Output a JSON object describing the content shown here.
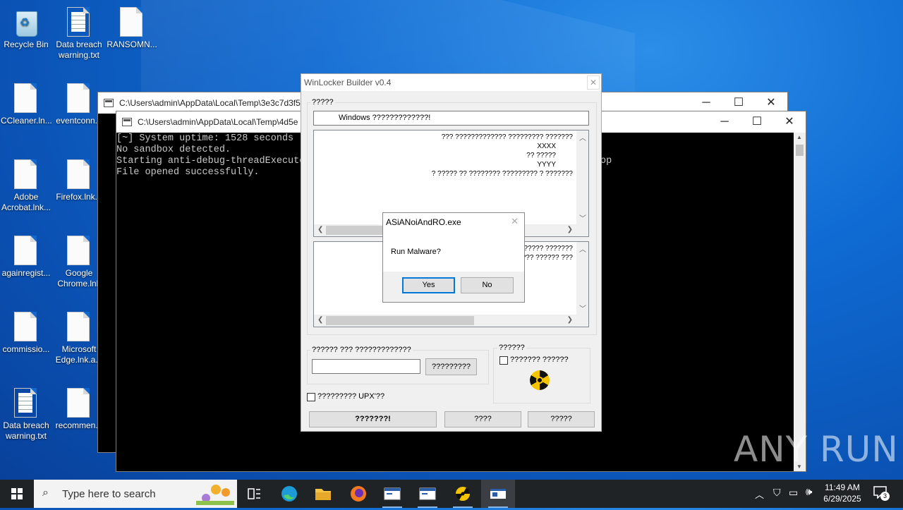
{
  "desktop": {
    "icons": [
      {
        "label": "Recycle Bin"
      },
      {
        "label": "Data breach warning.txt"
      },
      {
        "label": "RANSOMN..."
      },
      {
        "label": "CCleaner.ln..."
      },
      {
        "label": "eventconn..."
      },
      {
        "label": "Adobe Acrobat.lnk..."
      },
      {
        "label": "Firefox.lnk..."
      },
      {
        "label": "againregist..."
      },
      {
        "label": "Google Chrome.lnk"
      },
      {
        "label": "commissio..."
      },
      {
        "label": "Microsoft Edge.lnk.a..."
      },
      {
        "label": "Data breach warning.txt"
      },
      {
        "label": "recommen..."
      }
    ]
  },
  "console_back": {
    "title": "C:\\Users\\admin\\AppData\\Local\\Temp\\3e3c7d3f5"
  },
  "console_front": {
    "title": "C:\\Users\\admin\\AppData\\Local\\Temp\\4d5e",
    "lines": [
      "[~] System uptime: 1528 seconds",
      "No sandbox detected.",
      "Starting anti-debug-threadExecute",
      "File opened successfully."
    ],
    "clipped_tail": "op"
  },
  "winlocker": {
    "title": "WinLocker Builder v0.4",
    "group1_label": "?????",
    "header_input": "Windows ?????????????!",
    "memo1_lines": [
      "??? ????????????? ????????? ???????",
      "XXXX",
      "?? ?????",
      "YYYY",
      "? ????? ?? ???????? ????????? ? ???????"
    ],
    "memo2_lines": [
      "????? ???????",
      "??? ?????? ???"
    ],
    "group2_label": "?????? ??? ?????????????",
    "password_value": "",
    "browse_button": "?????????",
    "group3_label": "??????",
    "checkbox_label": "??????? ??????",
    "upx_label": "????????? UPX'??",
    "build_button": "???????!",
    "btn_mid": "????",
    "btn_right": "?????"
  },
  "dialog": {
    "title": "ASiANoiAndRO.exe",
    "message": "Run Malware?",
    "yes": "Yes",
    "no": "No"
  },
  "taskbar": {
    "search_placeholder": "Type here to search",
    "time": "11:49 AM",
    "date": "6/29/2025",
    "notification_count": "3"
  },
  "watermark": "ANY RUN"
}
